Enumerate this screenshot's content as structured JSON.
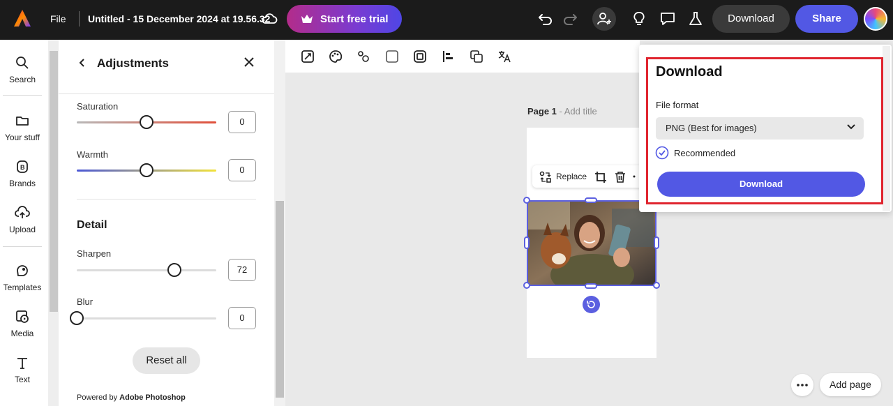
{
  "topbar": {
    "file_label": "File",
    "doc_title": "Untitled - 15 December 2024 at 19.56.32",
    "trial_label": "Start free trial",
    "download_label": "Download",
    "share_label": "Share",
    "icons": [
      "adobe-express-logo",
      "cloud-icon",
      "crown-icon",
      "undo-icon",
      "redo-icon",
      "invite-user-icon",
      "lightbulb-icon",
      "comment-icon",
      "flask-icon",
      "avatar"
    ]
  },
  "rail": {
    "items": [
      {
        "label": "Search",
        "icon": "search-icon"
      },
      {
        "label": "Your stuff",
        "icon": "folder-icon"
      },
      {
        "label": "Brands",
        "icon": "brand-icon"
      },
      {
        "label": "Upload",
        "icon": "upload-icon"
      },
      {
        "label": "Templates",
        "icon": "templates-icon"
      },
      {
        "label": "Media",
        "icon": "media-icon"
      },
      {
        "label": "Text",
        "icon": "text-icon"
      }
    ]
  },
  "panel": {
    "title": "Adjustments",
    "sliders": [
      {
        "label": "Saturation",
        "value": "0",
        "fraction": 0.5
      },
      {
        "label": "Warmth",
        "value": "0",
        "fraction": 0.5
      },
      {
        "label": "Sharpen",
        "value": "72",
        "fraction": 0.7
      },
      {
        "label": "Blur",
        "value": "0",
        "fraction": 0.0
      }
    ],
    "detail_section": "Detail",
    "reset_label": "Reset all",
    "powered_prefix": "Powered by",
    "powered_brand": "Adobe Photoshop"
  },
  "canvas": {
    "page_label": "Page 1",
    "page_label_sep": " - ",
    "add_title": "Add title",
    "replace_label": "Replace",
    "add_page_label": "Add page"
  },
  "download_popover": {
    "title": "Download",
    "file_format_label": "File format",
    "file_format_value": "PNG (Best for images)",
    "recommended_label": "Recommended",
    "download_button": "Download"
  },
  "colors": {
    "accent": "#5258e4",
    "topbar": "#1b1b1b",
    "highlight": "#e0252f"
  }
}
